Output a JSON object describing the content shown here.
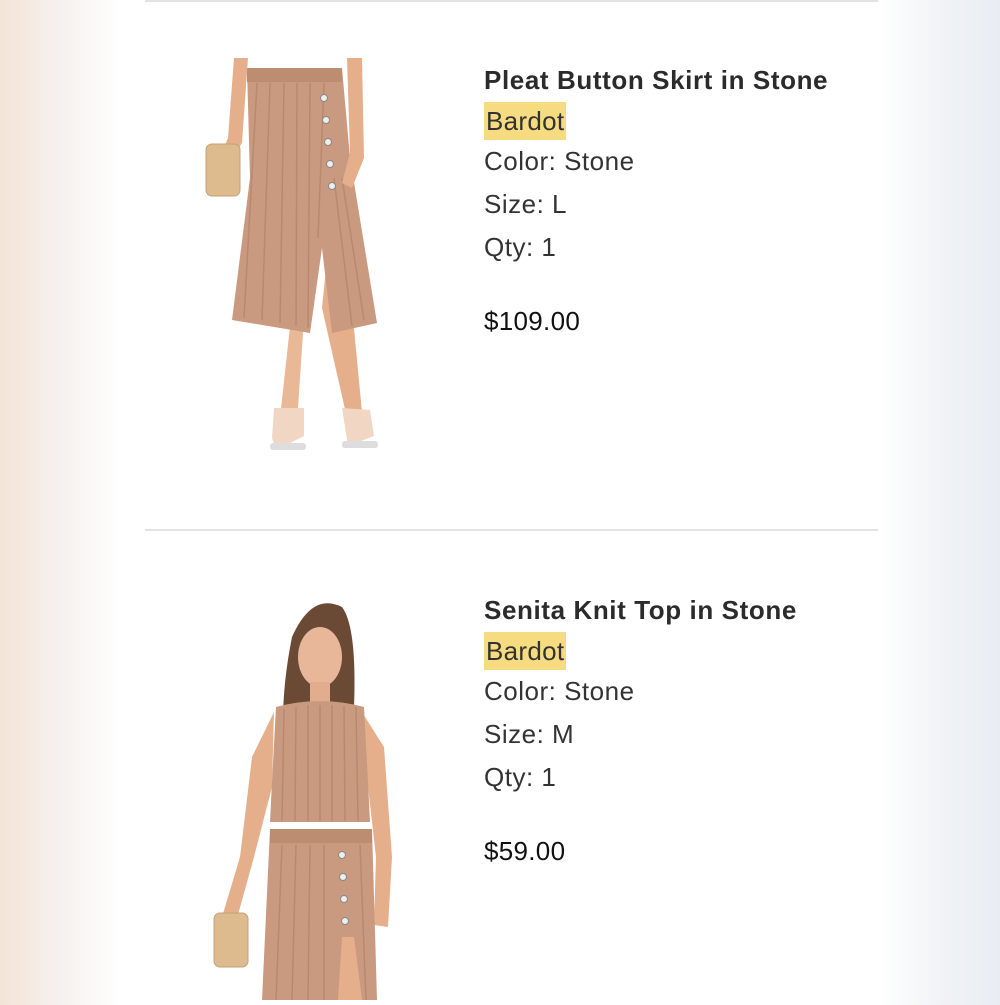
{
  "items": [
    {
      "title": "Pleat Button Skirt in Stone",
      "brand": "Bardot",
      "color": "Color: Stone",
      "size": "Size: L",
      "qty": "Qty: 1",
      "price": "$109.00",
      "image": "skirt-product-photo"
    },
    {
      "title": "Senita Knit Top in Stone",
      "brand": "Bardot",
      "color": "Color: Stone",
      "size": "Size: M",
      "qty": "Qty: 1",
      "price": "$59.00",
      "image": "top-product-photo"
    }
  ],
  "colors": {
    "brand_highlight": "#f7db80",
    "knit": "#c99a80",
    "divider": "#e3e3e3"
  }
}
